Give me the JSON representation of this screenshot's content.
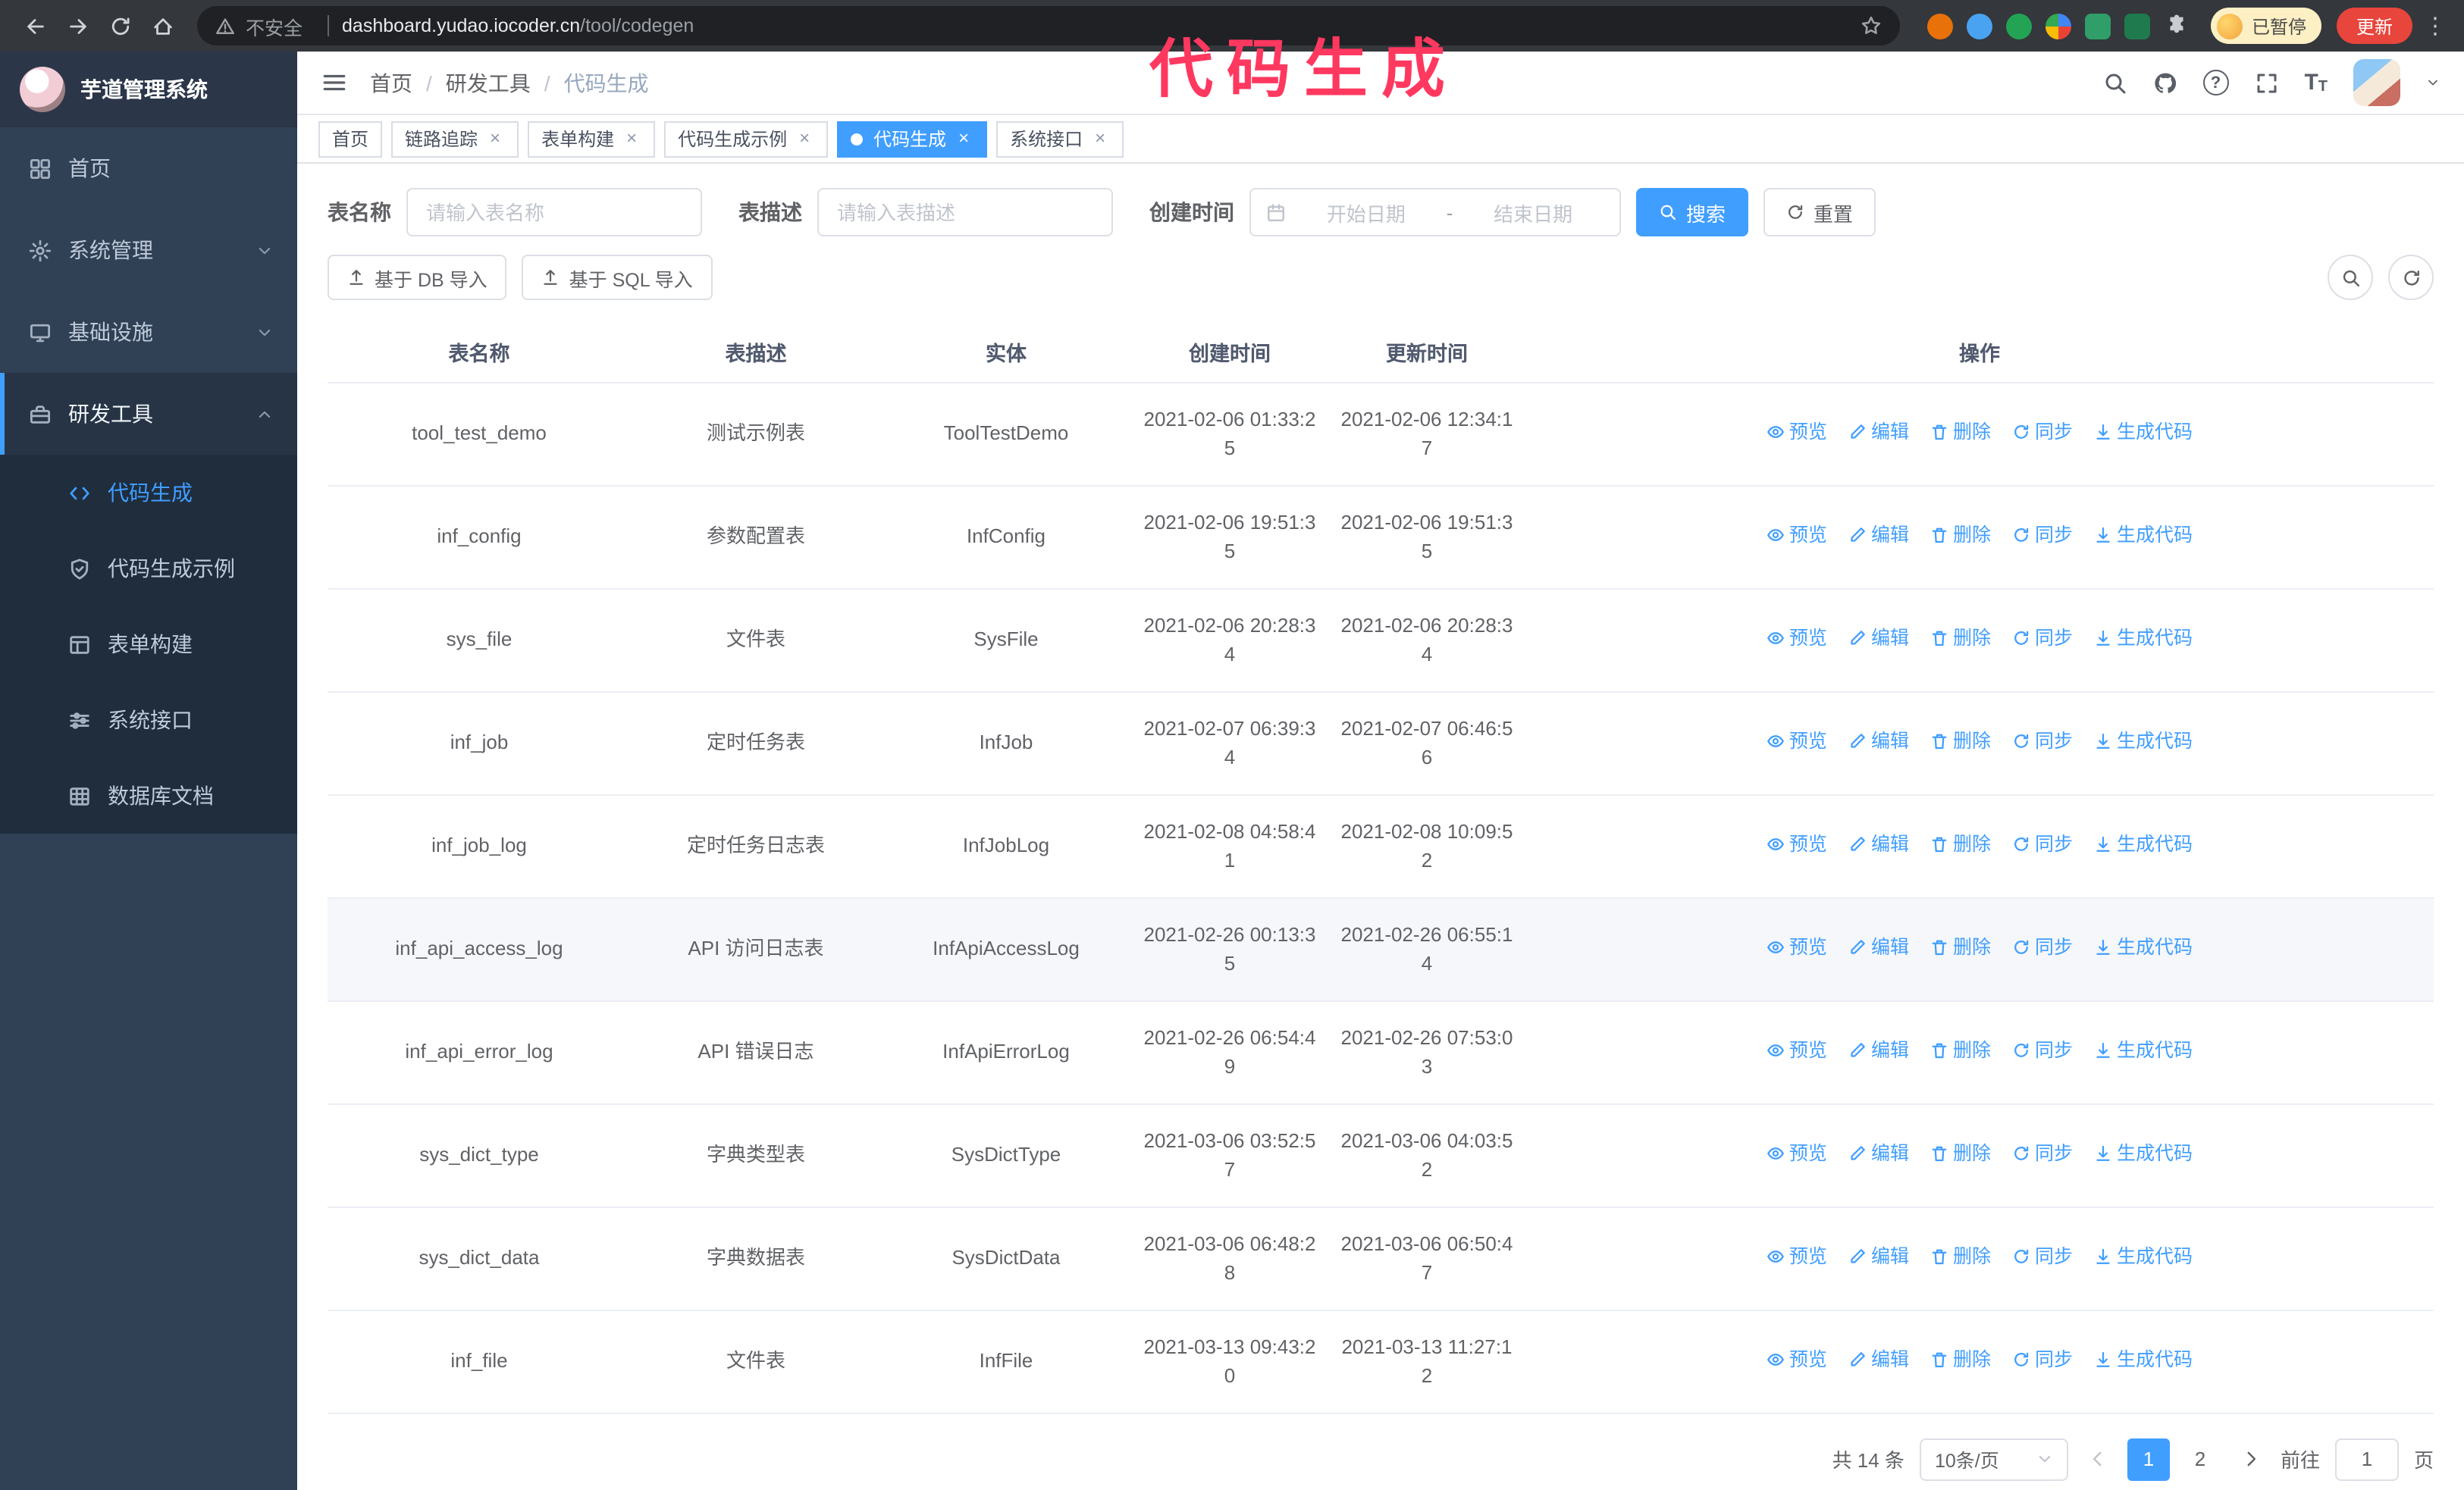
{
  "browser": {
    "security_label": "不安全",
    "url_domain": "dashboard.yudao.iocoder.cn",
    "url_path": "/tool/codegen",
    "paused_badge": "已暂停",
    "update_button": "更新"
  },
  "annotation": "代码生成",
  "sidebar": {
    "logo_title": "芋道管理系统",
    "items": [
      {
        "id": "home",
        "label": "首页",
        "icon": "dashboard-icon",
        "expandable": false,
        "expanded": false
      },
      {
        "id": "system-admin",
        "label": "系统管理",
        "icon": "gear-icon",
        "expandable": true,
        "expanded": false
      },
      {
        "id": "infrastructure",
        "label": "基础设施",
        "icon": "monitor-icon",
        "expandable": true,
        "expanded": false
      },
      {
        "id": "dev-tools",
        "label": "研发工具",
        "icon": "toolbox-icon",
        "expandable": true,
        "expanded": true
      }
    ],
    "submenu": [
      {
        "id": "codegen",
        "label": "代码生成",
        "icon": "code-icon",
        "active": true
      },
      {
        "id": "codegen-example",
        "label": "代码生成示例",
        "icon": "shield-icon",
        "active": false
      },
      {
        "id": "form-builder",
        "label": "表单构建",
        "icon": "form-icon",
        "active": false
      },
      {
        "id": "system-api",
        "label": "系统接口",
        "icon": "sliders-icon",
        "active": false
      },
      {
        "id": "db-doc",
        "label": "数据库文档",
        "icon": "grid-icon",
        "active": false
      }
    ]
  },
  "header": {
    "breadcrumb": [
      "首页",
      "研发工具",
      "代码生成"
    ]
  },
  "tabs": [
    {
      "id": "home",
      "label": "首页",
      "closable": false,
      "active": false
    },
    {
      "id": "tracer",
      "label": "链路追踪",
      "closable": true,
      "active": false
    },
    {
      "id": "form-builder",
      "label": "表单构建",
      "closable": true,
      "active": false
    },
    {
      "id": "codegen-example",
      "label": "代码生成示例",
      "closable": true,
      "active": false
    },
    {
      "id": "codegen",
      "label": "代码生成",
      "closable": true,
      "active": true
    },
    {
      "id": "system-api",
      "label": "系统接口",
      "closable": true,
      "active": false
    }
  ],
  "filters": {
    "table_name_label": "表名称",
    "table_name_placeholder": "请输入表名称",
    "table_desc_label": "表描述",
    "table_desc_placeholder": "请输入表描述",
    "create_time_label": "创建时间",
    "date_start_placeholder": "开始日期",
    "date_separator": "-",
    "date_end_placeholder": "结束日期",
    "search_button": "搜索",
    "reset_button": "重置"
  },
  "toolbar": {
    "import_db": "基于 DB 导入",
    "import_sql": "基于 SQL 导入"
  },
  "table": {
    "columns": [
      "表名称",
      "表描述",
      "实体",
      "创建时间",
      "更新时间",
      "操作"
    ],
    "actions": [
      "预览",
      "编辑",
      "删除",
      "同步",
      "生成代码"
    ],
    "rows": [
      {
        "name": "tool_test_demo",
        "desc": "测试示例表",
        "entity": "ToolTestDemo",
        "created": "2021-02-06 01:33:25",
        "updated": "2021-02-06 12:34:17",
        "hover": false
      },
      {
        "name": "inf_config",
        "desc": "参数配置表",
        "entity": "InfConfig",
        "created": "2021-02-06 19:51:35",
        "updated": "2021-02-06 19:51:35",
        "hover": false
      },
      {
        "name": "sys_file",
        "desc": "文件表",
        "entity": "SysFile",
        "created": "2021-02-06 20:28:34",
        "updated": "2021-02-06 20:28:34",
        "hover": false
      },
      {
        "name": "inf_job",
        "desc": "定时任务表",
        "entity": "InfJob",
        "created": "2021-02-07 06:39:34",
        "updated": "2021-02-07 06:46:56",
        "hover": false
      },
      {
        "name": "inf_job_log",
        "desc": "定时任务日志表",
        "entity": "InfJobLog",
        "created": "2021-02-08 04:58:41",
        "updated": "2021-02-08 10:09:52",
        "hover": false
      },
      {
        "name": "inf_api_access_log",
        "desc": "API 访问日志表",
        "entity": "InfApiAccessLog",
        "created": "2021-02-26 00:13:35",
        "updated": "2021-02-26 06:55:14",
        "hover": true
      },
      {
        "name": "inf_api_error_log",
        "desc": "API 错误日志",
        "entity": "InfApiErrorLog",
        "created": "2021-02-26 06:54:49",
        "updated": "2021-02-26 07:53:03",
        "hover": false
      },
      {
        "name": "sys_dict_type",
        "desc": "字典类型表",
        "entity": "SysDictType",
        "created": "2021-03-06 03:52:57",
        "updated": "2021-03-06 04:03:52",
        "hover": false
      },
      {
        "name": "sys_dict_data",
        "desc": "字典数据表",
        "entity": "SysDictData",
        "created": "2021-03-06 06:48:28",
        "updated": "2021-03-06 06:50:47",
        "hover": false
      },
      {
        "name": "inf_file",
        "desc": "文件表",
        "entity": "InfFile",
        "created": "2021-03-13 09:43:20",
        "updated": "2021-03-13 11:27:12",
        "hover": false
      }
    ]
  },
  "pagination": {
    "total": "共 14 条",
    "page_size": "10条/页",
    "pages": [
      "1",
      "2"
    ],
    "active_page": "1",
    "goto_label": "前往",
    "goto_value": "1",
    "goto_suffix": "页"
  },
  "colors": {
    "accent": "#409eff",
    "sidebar_bg": "#304156",
    "submenu_bg": "#1f2d3d",
    "annotation_pink": "#ff3860"
  }
}
